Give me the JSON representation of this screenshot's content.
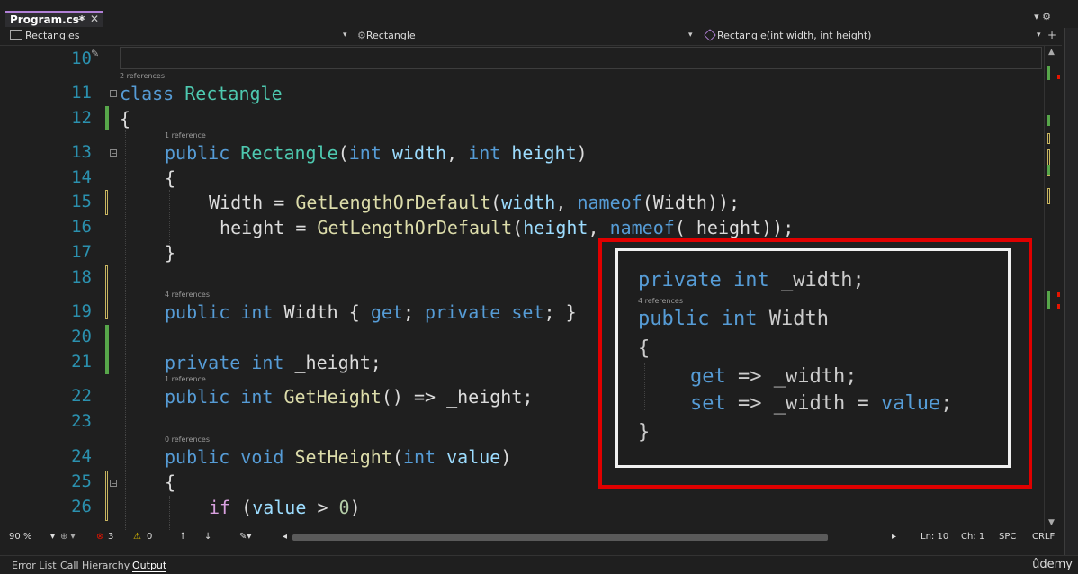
{
  "tab": {
    "title": "Program.cs*",
    "pin_icon": "pin-icon",
    "close": "✕"
  },
  "top_right": "▾ ⚙",
  "navbar": {
    "project": "Rectangles",
    "type": "Rectangle",
    "member": "Rectangle(int width, int height)",
    "split": "+"
  },
  "lines": [
    {
      "num": "10",
      "lens": "2 references"
    },
    {
      "num": "11"
    },
    {
      "num": "12"
    },
    {
      "num": "13",
      "lens": "1 reference"
    },
    {
      "num": "14"
    },
    {
      "num": "15"
    },
    {
      "num": "16"
    },
    {
      "num": "17"
    },
    {
      "num": "18"
    },
    {
      "num": "19",
      "lens": "4 references"
    },
    {
      "num": "20"
    },
    {
      "num": "21"
    },
    {
      "num": "22",
      "lens": "1 reference"
    },
    {
      "num": "23"
    },
    {
      "num": "24",
      "lens": "0 references"
    },
    {
      "num": "25"
    },
    {
      "num": "26"
    }
  ],
  "code": {
    "l11_kw": "class",
    "l11_ty": "Rectangle",
    "l12": "{",
    "l13_kw": "public",
    "l13_ty": "Rectangle",
    "l13_p1": "(",
    "l13_kw2": "int",
    "l13_pa1": "width",
    "l13_c": ",",
    "l13_kw3": "int",
    "l13_pa2": "height",
    "l13_p2": ")",
    "l14": "{",
    "l15_a": "Width =",
    "l15_fn": "GetLengthOrDefault",
    "l15_b": "(",
    "l15_pa": "width",
    "l15_c": ",",
    "l15_kw": "nameof",
    "l15_d": "(Width));",
    "l16_a": "_height =",
    "l16_fn": "GetLengthOrDefault",
    "l16_b": "(",
    "l16_pa": "height",
    "l16_c": ",",
    "l16_kw": "nameof",
    "l16_d": "(_height));",
    "l17": "}",
    "l19_kw": "public",
    "l19_kw2": "int",
    "l19_a": "Width {",
    "l19_kw3": "get",
    "l19_b": ";",
    "l19_kw4": "private set",
    "l19_c": "; }",
    "l21_kw": "private",
    "l21_kw2": "int",
    "l21_a": "_height;",
    "l22_kw": "public",
    "l22_kw2": "int",
    "l22_fn": "GetHeight",
    "l22_a": "() => _height;",
    "l24_kw": "public",
    "l24_kw2": "void",
    "l24_fn": "SetHeight",
    "l24_a": "(",
    "l24_kw3": "int",
    "l24_pa": "value",
    "l24_b": ")",
    "l25": "{",
    "l26_ctl": "if",
    "l26_a": "(",
    "l26_pa": "value",
    "l26_b": ">",
    "l26_num": "0",
    "l26_c": ")"
  },
  "overlay": {
    "l1_kw": "private",
    "l1_kw2": "int",
    "l1_a": "_width;",
    "lens": "4 references",
    "l2_kw": "public",
    "l2_kw2": "int",
    "l2_a": "Width",
    "l3": "{",
    "l4_kw": "get",
    "l4_a": "=> _width;",
    "l5_kw": "set",
    "l5_a": "=> _width =",
    "l5_kw2": "value",
    "l5_b": ";",
    "l6": "}"
  },
  "status": {
    "zoom": "90 %",
    "errors": "3",
    "warnings": "0",
    "ln": "Ln: 10",
    "ch": "Ch: 1",
    "spc": "SPC",
    "crlf": "CRLF"
  },
  "bottom_tabs": [
    "Error List",
    "Call Hierarchy",
    "Output"
  ],
  "watermark": "ûdemy",
  "colors": {
    "accent": "#b180d7",
    "highlight_border": "#e00000",
    "keyword": "#569cd6",
    "type": "#4ec9b0",
    "method": "#dcdcaa",
    "param": "#9cdcfe"
  }
}
